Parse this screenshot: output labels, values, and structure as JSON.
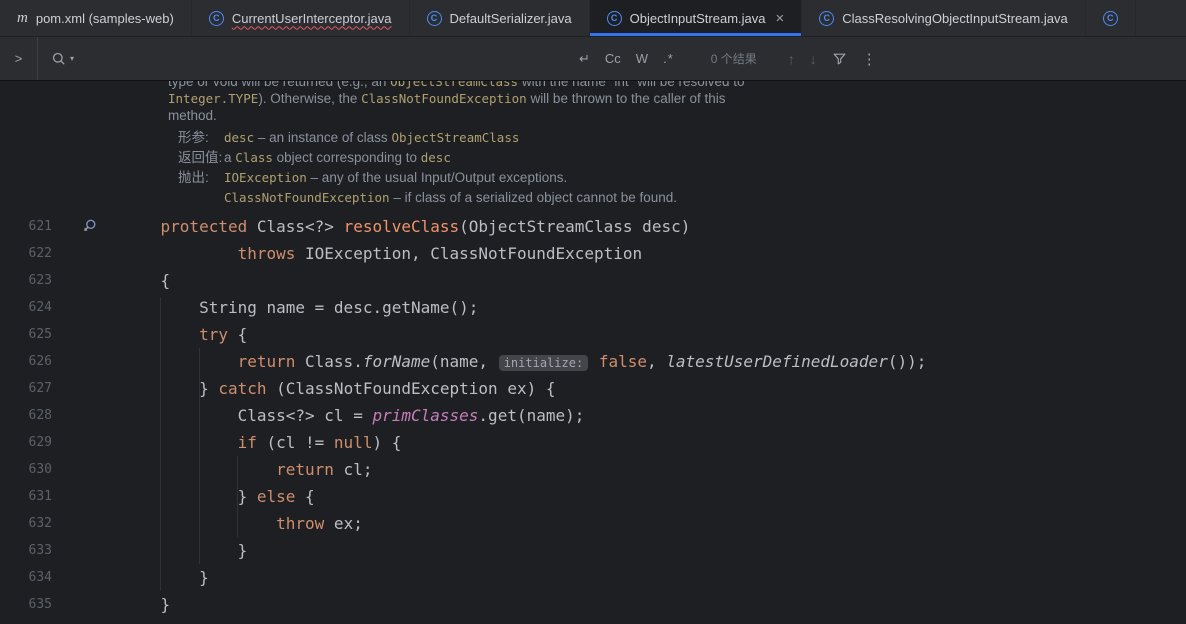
{
  "colors": {
    "accent": "#3574f0",
    "tab_bar_bg": "#2b2d30",
    "editor_bg": "#1e1f22",
    "keyword": "#cf8e6d",
    "method_declaration": "#f0936b",
    "static_field": "#c77dbb",
    "doc_text": "#8a919d",
    "doc_code": "#b0a070",
    "error_wave": "#e55765"
  },
  "icons": {
    "java_class_letter": "C",
    "maven_letter": "m"
  },
  "tabs": [
    {
      "label": "pom.xml (samples-web)",
      "icon": "maven-icon",
      "active": false,
      "error": false,
      "closable": false
    },
    {
      "label": "CurrentUserInterceptor.java",
      "icon": "java-class-icon",
      "active": false,
      "error": true,
      "closable": false
    },
    {
      "label": "DefaultSerializer.java",
      "icon": "java-class-icon",
      "active": false,
      "error": false,
      "closable": false
    },
    {
      "label": "ObjectInputStream.java",
      "icon": "java-class-icon",
      "active": true,
      "error": false,
      "closable": true,
      "close_glyph": "×"
    },
    {
      "label": "ClassResolvingObjectInputStream.java",
      "icon": "java-class-icon",
      "active": false,
      "error": false,
      "closable": false
    },
    {
      "label": "",
      "icon": "java-class-icon",
      "active": false,
      "error": false,
      "closable": false
    }
  ],
  "find_bar": {
    "expand_glyph": ">",
    "history_caret_glyph": "▾",
    "newline_glyph": "↵",
    "match_case_label": "Cc",
    "words_label": "W",
    "regex_label": ".*",
    "results_text": "0 个结果",
    "prev_glyph": "↑",
    "next_glyph": "↓",
    "more_glyph": "⋮"
  },
  "doc": {
    "lines": [
      {
        "type": "body",
        "tokens": [
          [
            "type or void will be returned (e.g., an ",
            "t"
          ],
          [
            "ObjectStreamClass",
            "c"
          ],
          [
            " with the name \"int\" will be resolved to",
            "t"
          ]
        ]
      },
      {
        "type": "body",
        "tokens": [
          [
            "Integer.TYPE",
            "c"
          ],
          [
            "). Otherwise, the ",
            "t"
          ],
          [
            "ClassNotFoundException",
            "c"
          ],
          [
            " will be thrown to the caller of this",
            "t"
          ]
        ]
      },
      {
        "type": "body",
        "tokens": [
          [
            "method.",
            "t"
          ]
        ]
      },
      {
        "type": "section",
        "first": true,
        "label": "形参:",
        "tokens": [
          [
            "desc",
            "c"
          ],
          [
            " – an instance of class ",
            "t"
          ],
          [
            "ObjectStreamClass",
            "c"
          ]
        ]
      },
      {
        "type": "section",
        "label": "返回值:",
        "tokens": [
          [
            "a ",
            "t"
          ],
          [
            "Class",
            "c"
          ],
          [
            " object corresponding to ",
            "t"
          ],
          [
            "desc",
            "c"
          ]
        ]
      },
      {
        "type": "section",
        "label": "抛出:",
        "tokens": [
          [
            "IOException",
            "c"
          ],
          [
            " – any of the usual Input/Output exceptions.",
            "t"
          ]
        ]
      },
      {
        "type": "cont",
        "tokens": [
          [
            "ClassNotFoundException",
            "c"
          ],
          [
            " – if class of a serialized object cannot be found.",
            "t"
          ]
        ]
      }
    ]
  },
  "code": {
    "lines": [
      {
        "number": 621,
        "gutter_icon": true,
        "tokens": [
          [
            "    ",
            "pl"
          ],
          [
            "protected",
            "kw"
          ],
          [
            " Class<?> ",
            "pl"
          ],
          [
            "resolveClass",
            "md"
          ],
          [
            "(ObjectStreamClass desc)",
            "pl"
          ]
        ]
      },
      {
        "number": 622,
        "tokens": [
          [
            "            ",
            "pl"
          ],
          [
            "throws",
            "kw"
          ],
          [
            " IOException, ClassNotFoundException",
            "pl"
          ]
        ]
      },
      {
        "number": 623,
        "tokens": [
          [
            "    {",
            "pl"
          ]
        ]
      },
      {
        "number": 624,
        "tokens": [
          [
            "        String name = desc.getName();",
            "pl"
          ]
        ]
      },
      {
        "number": 625,
        "tokens": [
          [
            "        ",
            "pl"
          ],
          [
            "try",
            "kw"
          ],
          [
            " {",
            "pl"
          ]
        ]
      },
      {
        "number": 626,
        "tokens": [
          [
            "            ",
            "pl"
          ],
          [
            "return",
            "kw"
          ],
          [
            " Class.",
            "pl"
          ],
          [
            "forName",
            "st"
          ],
          [
            "(name, ",
            "pl"
          ],
          [
            "initialize:",
            "inlay"
          ],
          [
            " ",
            "pl"
          ],
          [
            "false",
            "kw"
          ],
          [
            ", ",
            "pl"
          ],
          [
            "latestUserDefinedLoader",
            "st"
          ],
          [
            "());",
            "pl"
          ]
        ]
      },
      {
        "number": 627,
        "tokens": [
          [
            "        } ",
            "pl"
          ],
          [
            "catch",
            "kw"
          ],
          [
            " (ClassNotFoundException ex) {",
            "pl"
          ]
        ]
      },
      {
        "number": 628,
        "tokens": [
          [
            "            Class<?> cl = ",
            "pl"
          ],
          [
            "primClasses",
            "fl"
          ],
          [
            ".get(name);",
            "pl"
          ]
        ]
      },
      {
        "number": 629,
        "tokens": [
          [
            "            ",
            "pl"
          ],
          [
            "if",
            "kw"
          ],
          [
            " (cl != ",
            "pl"
          ],
          [
            "null",
            "kw"
          ],
          [
            ") {",
            "pl"
          ]
        ]
      },
      {
        "number": 630,
        "tokens": [
          [
            "                ",
            "pl"
          ],
          [
            "return",
            "kw"
          ],
          [
            " cl;",
            "pl"
          ]
        ]
      },
      {
        "number": 631,
        "tokens": [
          [
            "            } ",
            "pl"
          ],
          [
            "else",
            "kw"
          ],
          [
            " {",
            "pl"
          ]
        ]
      },
      {
        "number": 632,
        "tokens": [
          [
            "                ",
            "pl"
          ],
          [
            "throw",
            "kw"
          ],
          [
            " ex;",
            "pl"
          ]
        ]
      },
      {
        "number": 633,
        "tokens": [
          [
            "            }",
            "pl"
          ]
        ]
      },
      {
        "number": 634,
        "tokens": [
          [
            "        }",
            "pl"
          ]
        ]
      },
      {
        "number": 635,
        "tokens": [
          [
            "    }",
            "pl"
          ]
        ]
      }
    ]
  }
}
